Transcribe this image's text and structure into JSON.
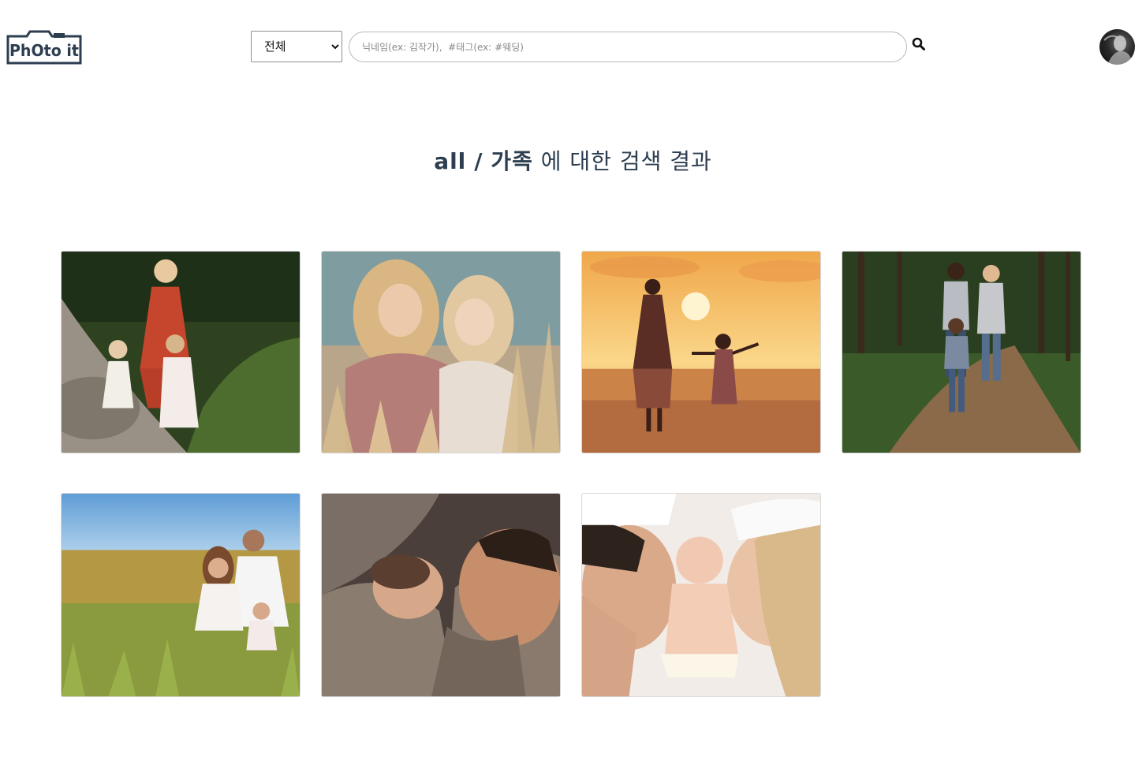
{
  "header": {
    "logo_text": "PhOto it",
    "category": {
      "selected": "전체",
      "options": [
        "전체"
      ]
    },
    "search": {
      "placeholder": "닉네임(ex: 김작가),  #태그(ex: #웨딩)",
      "value": ""
    },
    "search_icon": "search-icon",
    "avatar_icon": "user-avatar"
  },
  "results": {
    "category": "all",
    "separator": "/",
    "query": "가족",
    "suffix": "에 대한 검색 결과"
  },
  "photos": [
    {
      "subject": "mother dancing with two little girls on forest path",
      "colors": [
        "#3f5a2a",
        "#c44a2e"
      ]
    },
    {
      "subject": "mother and daughter among wheat grass",
      "colors": [
        "#8fa9a8",
        "#d8b68a"
      ]
    },
    {
      "subject": "mother and child silhouette at sunset beach",
      "colors": [
        "#f2b24a",
        "#a84a3a"
      ]
    },
    {
      "subject": "parents and toddler walking on forest trail",
      "colors": [
        "#2f4a2a",
        "#8a6a48"
      ]
    },
    {
      "subject": "family sitting in tall grass field",
      "colors": [
        "#6fa3d6",
        "#b79a4a"
      ]
    },
    {
      "subject": "father cuddling sleeping newborn",
      "colors": [
        "#6a5a52",
        "#b39a8a"
      ]
    },
    {
      "subject": "parents lying beside baby on white blanket",
      "colors": [
        "#efe9e4",
        "#d9b294"
      ]
    }
  ]
}
